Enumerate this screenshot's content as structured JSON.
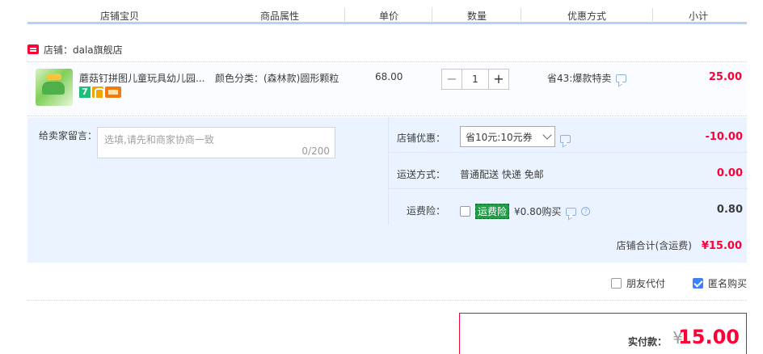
{
  "header": {
    "columns": [
      "店铺宝贝",
      "商品属性",
      "单价",
      "数量",
      "优惠方式",
      "小计"
    ]
  },
  "shop": {
    "name": "店铺：dala旗舰店"
  },
  "item": {
    "title": "蘑菇钉拼图儿童玩具幼儿园...",
    "badge_7": "7",
    "attribute": "颜色分类：(森林款)圆形颗粒",
    "price": "68.00",
    "quantity": "1",
    "minus": "−",
    "plus": "+",
    "discount": "省43:爆款特卖",
    "subtotal": "25.00"
  },
  "memo": {
    "label": "给卖家留言：",
    "placeholder": "选填,请先和商家协商一致",
    "count": "0/200"
  },
  "coupon": {
    "label": "店铺优惠：",
    "selected": "省10元:10元券",
    "amount": "-10.00"
  },
  "shipping": {
    "label": "运送方式：",
    "value": "普通配送 快递 免邮",
    "amount": "0.00"
  },
  "insurance": {
    "label": "运费险：",
    "tag": "运费险",
    "price": "¥0.80购买",
    "amount": "0.80",
    "q": "?"
  },
  "shop_total": {
    "label": "店铺合计(含运费)",
    "value": "¥15.00"
  },
  "options": {
    "friend_pay": "朋友代付",
    "anonymous": "匿名购买"
  },
  "payment": {
    "label": "实付款：",
    "yen": "¥",
    "amount": "15.00"
  },
  "colors": {
    "accent": "#ff0036",
    "panel": "#eaf3ff",
    "header_line": "#b2d1ff"
  }
}
